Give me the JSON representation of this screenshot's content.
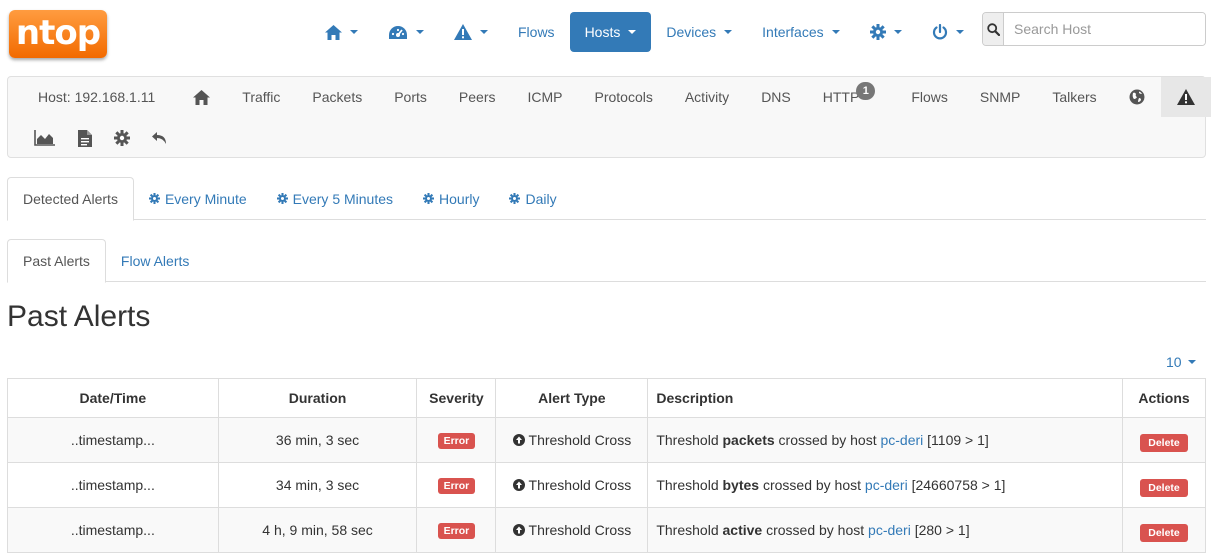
{
  "brand": {
    "logo_text": "ntop"
  },
  "topnav": {
    "flows": "Flows",
    "hosts": "Hosts",
    "devices": "Devices",
    "interfaces": "Interfaces"
  },
  "search": {
    "placeholder": "Search Host"
  },
  "host_nav": {
    "host_label": "Host: 192.168.1.11",
    "items": [
      "Traffic",
      "Packets",
      "Ports",
      "Peers",
      "ICMP",
      "Protocols",
      "Activity",
      "DNS",
      "HTTP",
      "Flows",
      "SNMP",
      "Talkers"
    ],
    "http_badge": "1"
  },
  "alert_tabs": {
    "detected": "Detected Alerts",
    "every_minute": "Every Minute",
    "every_5_minutes": "Every 5 Minutes",
    "hourly": "Hourly",
    "daily": "Daily"
  },
  "sub_tabs": {
    "past": "Past Alerts",
    "flow": "Flow Alerts"
  },
  "page_title": "Past Alerts",
  "page_size": "10",
  "table": {
    "headers": [
      "Date/Time",
      "Duration",
      "Severity",
      "Alert Type",
      "Description",
      "Actions"
    ],
    "rows": [
      {
        "datetime": "..timestamp...",
        "duration": "36 min, 3 sec",
        "severity": "Error",
        "type": "Threshold Cross",
        "desc_pre": "Threshold ",
        "desc_metric": "packets",
        "desc_mid": " crossed by host ",
        "desc_host": "pc-deri",
        "desc_post": " [1109 > 1]",
        "action": "Delete"
      },
      {
        "datetime": "..timestamp...",
        "duration": "34 min, 3 sec",
        "severity": "Error",
        "type": "Threshold Cross",
        "desc_pre": "Threshold ",
        "desc_metric": "bytes",
        "desc_mid": " crossed by host ",
        "desc_host": "pc-deri",
        "desc_post": " [24660758 > 1]",
        "action": "Delete"
      },
      {
        "datetime": "..timestamp...",
        "duration": "4 h, 9 min, 58 sec",
        "severity": "Error",
        "type": "Threshold Cross",
        "desc_pre": "Threshold ",
        "desc_metric": "active",
        "desc_mid": " crossed by host ",
        "desc_host": "pc-deri",
        "desc_post": " [280 > 1]",
        "action": "Delete"
      }
    ]
  },
  "colors": {
    "link": "#337ab7",
    "danger": "#d9534f",
    "brand_orange": "#f26a00"
  }
}
